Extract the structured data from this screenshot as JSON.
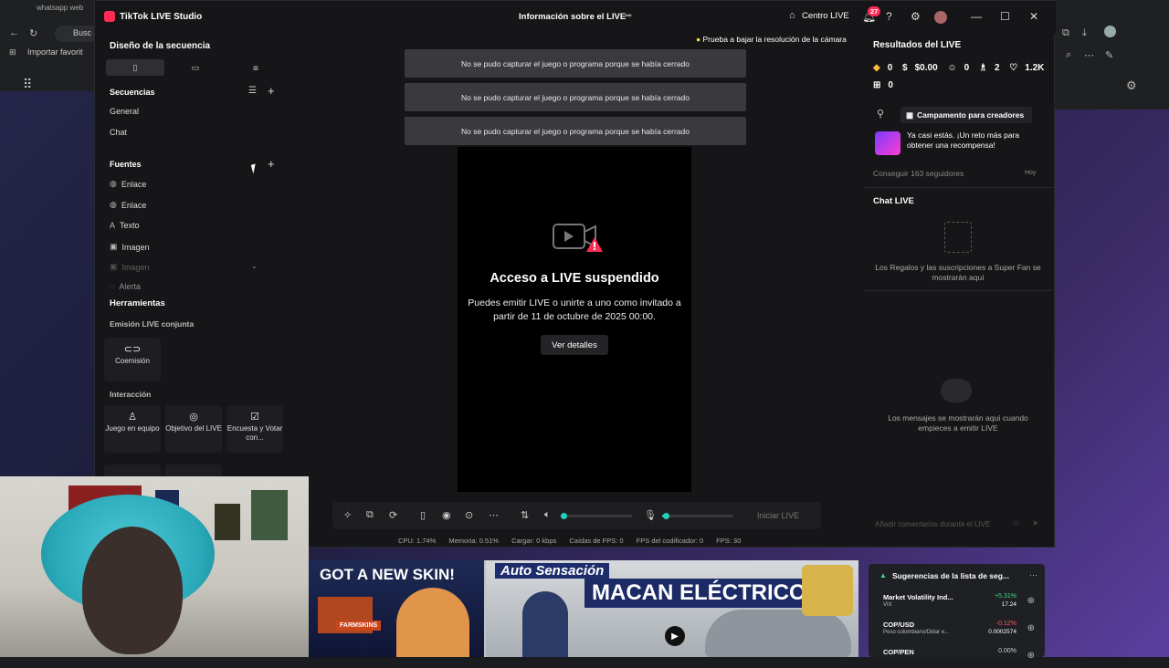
{
  "browser": {
    "tab_label": "whatsapp web",
    "search_text": "Busc",
    "bookmark": "Importar favorit"
  },
  "app": {
    "title": "TikTok LIVE Studio",
    "center_title": "Información sobre el LIVE",
    "centro_live": "Centro LIVE",
    "notifications_count": "27"
  },
  "left": {
    "design_title": "Diseño de la secuencia",
    "sequences_title": "Secuencias",
    "sequences": [
      "General",
      "Chat"
    ],
    "sources_title": "Fuentes",
    "sources": [
      {
        "label": "Enlace",
        "icon": "globe-icon"
      },
      {
        "label": "Enlace",
        "icon": "globe-icon"
      },
      {
        "label": "Texto",
        "icon": "text-icon"
      },
      {
        "label": "Imagen",
        "icon": "image-icon"
      },
      {
        "label": "Imagen",
        "icon": "image-icon"
      },
      {
        "label": "Alerta",
        "icon": "alert-icon"
      }
    ],
    "tools_title": "Herramientas",
    "coop_title": "Emisión LIVE conjunta",
    "coop_tool": "Coemisión",
    "interaction_title": "Interacción",
    "interaction_tools": [
      "Juego en equipo",
      "Objetivo del LIVE",
      "Encuesta y Votar con..."
    ]
  },
  "center": {
    "tip": "Prueba a bajar la resolución de la cámara",
    "errors": [
      "No se pudo capturar el juego o programa porque se había cerrado",
      "No se pudo capturar el juego o programa porque se había cerrado",
      "No se pudo capturar el juego o programa porque se había cerrado"
    ],
    "suspended_title": "Acceso a LIVE suspendido",
    "suspended_text": "Puedes emitir LIVE o unirte a uno como invitado a partir de 11 de octubre de 2025 00:00.",
    "details_button": "Ver detalles",
    "start_live": "Iniciar LIVE",
    "volume_level": 0.04,
    "mic_level": 0.05
  },
  "stats": {
    "cpu": "CPU: 1.74%",
    "memory": "Memoria: 0.51%",
    "upload": "Cargar: 0 kbps",
    "fps_drops": "Caídas de FPS: 0",
    "encoder_fps": "FPS del codificador: 0",
    "fps": "FPS: 30"
  },
  "right": {
    "results_title": "Resultados del LIVE",
    "stats": [
      "0",
      "$0.00",
      "0",
      "2",
      "1.2K",
      "0"
    ],
    "campaign_button": "Campamento para creadores",
    "campaign_text": "Ya casi estás. ¡Un reto más para obtener una recompensa!",
    "campaign_goal": "Conseguir 163 seguidores",
    "campaign_when": "Hoy",
    "chat_title": "Chat LIVE",
    "gifts_empty": "Los Regalos y las suscripciones a Super Fan se mostrarán aquí",
    "messages_empty": "Los mensajes se mostrarán aquí cuando empieces a emitir LIVE",
    "chat_placeholder": "Añadir comentarios durante el LIVE"
  },
  "ad": {
    "left_headline": "GOT A NEW SKIN!",
    "left_brand": "FARMSKINS",
    "right_brand": "Auto Sensación",
    "right_headline": "MACAN ELÉCTRICO"
  },
  "markets": {
    "title": "Sugerencias de la lista de seg...",
    "rows": [
      {
        "name": "Market Volatility Ind...",
        "sub": "VIX",
        "change": "+5.31%",
        "value": "17.24",
        "color": "#3ddc84"
      },
      {
        "name": "COP/USD",
        "sub": "Peso colombiano/Dólar e...",
        "change": "-0.12%",
        "value": "0.0002574",
        "color": "#ff5a5a"
      },
      {
        "name": "COP/PEN",
        "sub": "",
        "change": "0.00%",
        "value": "",
        "color": "#cccccc"
      }
    ]
  },
  "colors": {
    "accent": "#fe2c55",
    "slider": "#25d0b8"
  }
}
